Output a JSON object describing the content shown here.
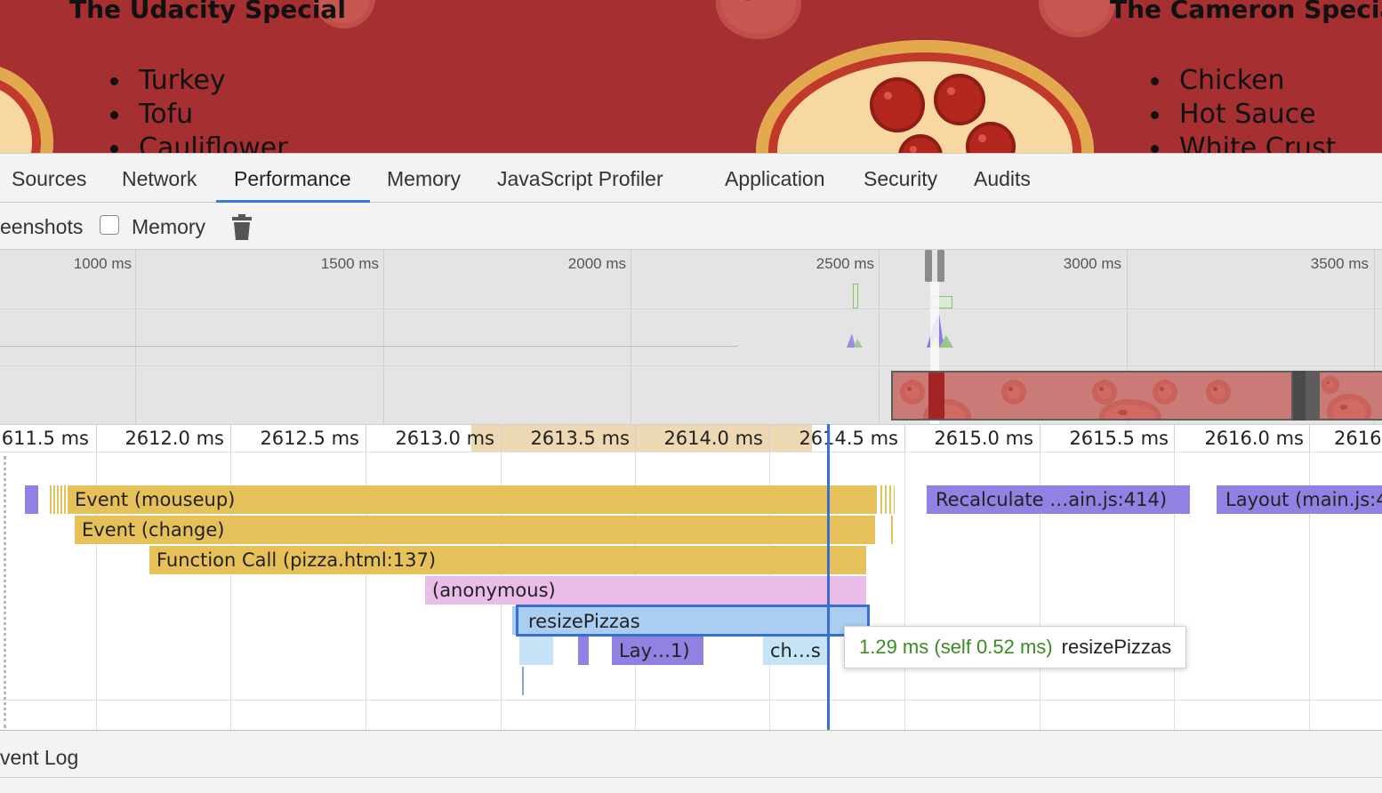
{
  "preview": {
    "left_card": {
      "title": "The Udacity Special",
      "ingredients": [
        "Turkey",
        "Tofu",
        "Cauliflower"
      ]
    },
    "right_card": {
      "title": "The Cameron Special",
      "ingredients": [
        "Chicken",
        "Hot Sauce",
        "White Crust"
      ]
    }
  },
  "devtools": {
    "tabs": [
      {
        "label": "Sources",
        "active": false
      },
      {
        "label": "Network",
        "active": false
      },
      {
        "label": "Performance",
        "active": true
      },
      {
        "label": "Memory",
        "active": false
      },
      {
        "label": "JavaScript Profiler",
        "active": false
      },
      {
        "label": "Application",
        "active": false
      },
      {
        "label": "Security",
        "active": false
      },
      {
        "label": "Audits",
        "active": false
      }
    ],
    "accent_color": "#3879d9"
  },
  "toolbar": {
    "screenshots_label": "eenshots",
    "memory_label": "Memory",
    "memory_checked": false,
    "trash_icon": "trash-icon"
  },
  "overview": {
    "ticks": [
      "1000 ms",
      "1500 ms",
      "2000 ms",
      "2500 ms",
      "3000 ms",
      "3500 ms"
    ]
  },
  "flame": {
    "ruler_ticks": [
      "611.5 ms",
      "2612.0 ms",
      "2612.5 ms",
      "2613.0 ms",
      "2613.5 ms",
      "2614.0 ms",
      "2614.5 ms",
      "2615.0 ms",
      "2615.5 ms",
      "2616.0 ms",
      "2616"
    ],
    "entries": {
      "event_mouseup": "Event (mouseup)",
      "event_change": "Event (change)",
      "function_call": "Function Call (pizza.html:137)",
      "anonymous": "(anonymous)",
      "resize_pizzas": "resizePizzas",
      "layout_short": "Lay…1)",
      "ch_short": "ch…s",
      "recalculate": "Recalculate …ain.js:414)",
      "layout_main": "Layout (main.js:4"
    },
    "tooltip": {
      "time": "1.29 ms (self 0.52 ms)",
      "name": "resizePizzas"
    },
    "colors": {
      "scripting": "#e6c15a",
      "rendering": "#9380e3",
      "anonymous": "#eabce8",
      "selected": "#a9cef2",
      "cursor": "#3a6fd1",
      "tooltip_time": "#3c8b22"
    }
  },
  "bottom": {
    "event_log_label": "vent Log"
  }
}
